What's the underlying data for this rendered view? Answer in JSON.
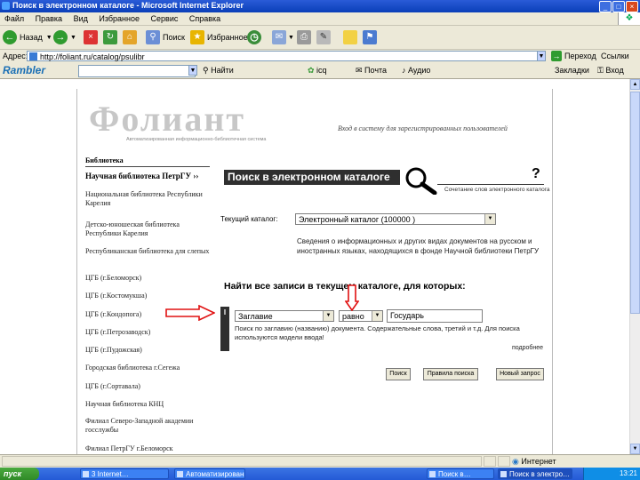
{
  "window": {
    "title": "Поиск в электронном каталоге - Microsoft Internet Explorer"
  },
  "menu": [
    "Файл",
    "Правка",
    "Вид",
    "Избранное",
    "Сервис",
    "Справка"
  ],
  "toolbar": {
    "back": "Назад",
    "search": "Поиск",
    "favorites": "Избранное"
  },
  "address": {
    "label": "Адрес:",
    "url": "http://foliant.ru/catalog/psulibr",
    "go": "Переход",
    "links": "Ссылки"
  },
  "rambler": {
    "logo": "Rambler",
    "find": "Найти",
    "mail": "Почта",
    "audio": "Аудио",
    "icq": "icq",
    "bookmarks": "Закладки",
    "login": "Вход"
  },
  "site": {
    "logo": "Фолиант",
    "logo_sub": "Автоматизированная информационно-библиотечная система",
    "tagline": "Вход в систему для зарегистрированных пользователей",
    "library_heading": "Библиотека",
    "current_library": "Научная библиотека ПетрГУ ››",
    "libraries": [
      "Национальная библиотека Республики Карелия",
      "Детско-юношеская библиотека Республики Карелия",
      "Республиканская библиотека для слепых",
      "ЦГБ (г.Беломорск)",
      "ЦГБ (г.Костомукша)",
      "ЦГБ (г.Кондопога)",
      "ЦГБ (г.Петрозаводск)",
      "ЦГБ (г.Пудожская)",
      "Городская библиотека г.Сегежа",
      "ЦГБ (г.Сортавала)",
      "Научная библиотека КНЦ",
      "Филиал Северо-Западной академии госслужбы",
      "Филиал ПетрГУ г.Беломорск"
    ],
    "search_title": "Поиск в электронном каталоге",
    "help": "?",
    "search_note": "Сочетание слов электронного каталога",
    "catalog_label": "Текущий каталог:",
    "catalog_value": "Электронный каталог (100000 )",
    "catalog_desc": "Сведения о информационных и других видах документов на русском и иностранных языках, находящихся в фонде Научной библиотеки ПетрГУ",
    "find_title": "Найти все записи в текущем каталоге, для которых:",
    "row_label": "I",
    "field_value": "Заглавие",
    "op_value": "равно",
    "query_value": "Государь",
    "field_hint": "Поиск по заглавию (названию) документа. Содержательные слова, третий и т.д. Для поиска используются модели ввода!",
    "more": "подробнее",
    "buttons": {
      "find": "Поиск",
      "rules": "Правила поиска",
      "new_search": "Новый запрос"
    }
  },
  "status": {
    "zone": "Интернет"
  },
  "taskbar": {
    "start": "пуск",
    "tasks": [
      "3 Internet…",
      "Автоматизированная…",
      "Поиск в…",
      "Поиск в электро…"
    ],
    "clock": "13:21"
  }
}
